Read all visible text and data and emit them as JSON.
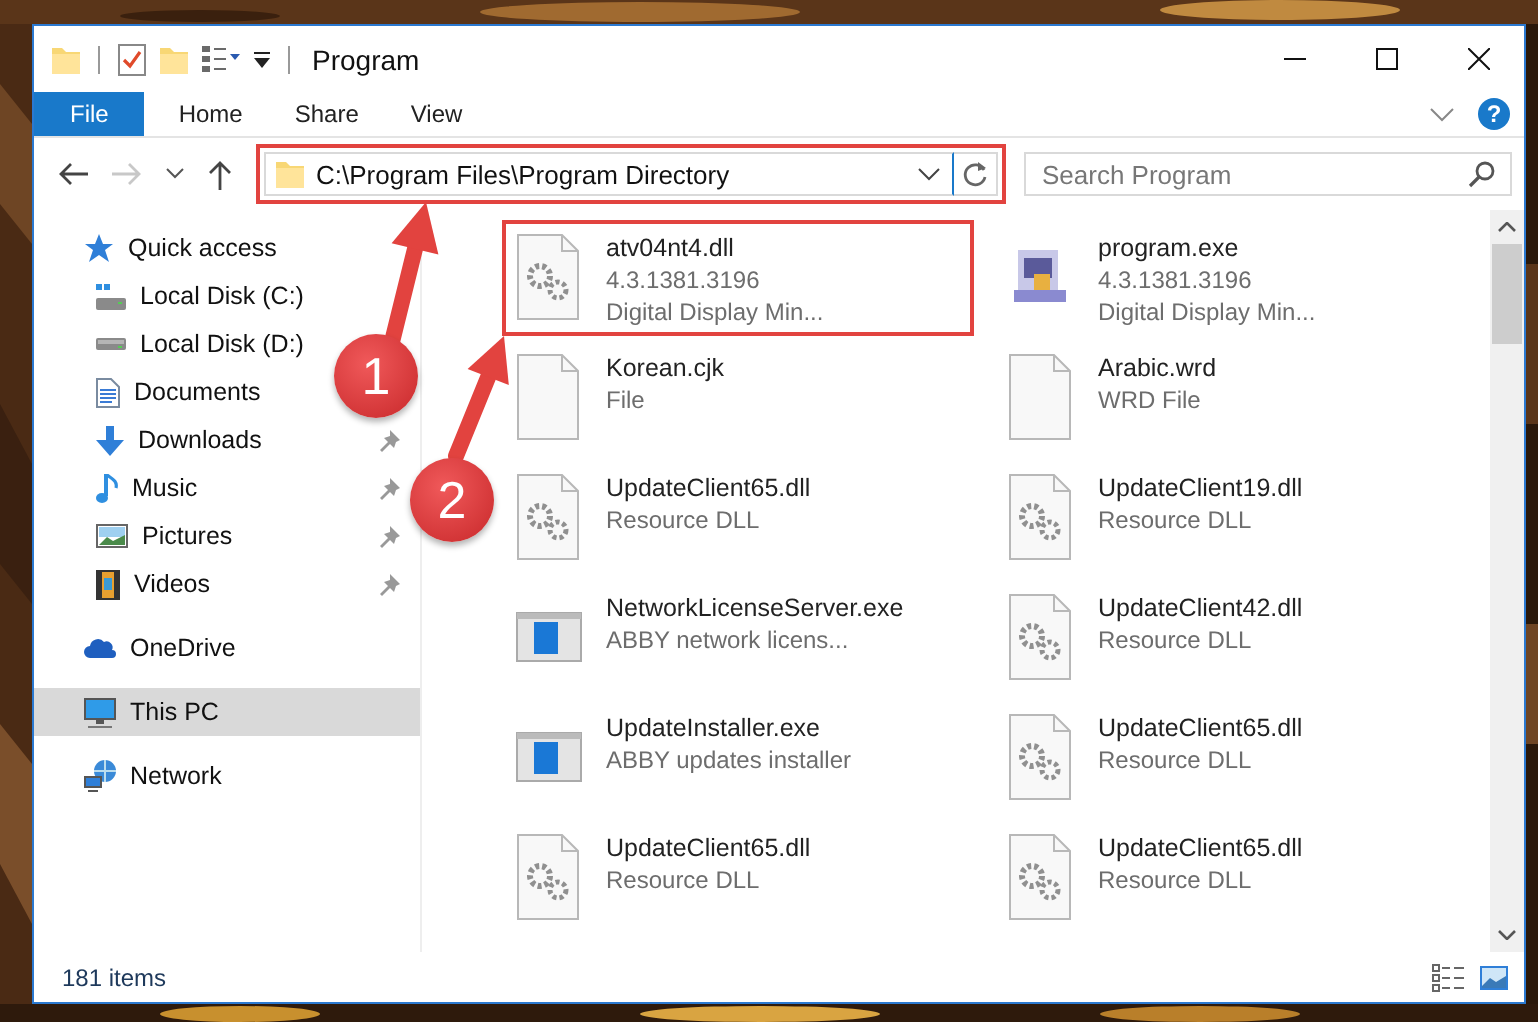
{
  "window": {
    "title": "Program"
  },
  "ribbon": {
    "tabs": [
      {
        "label": "File",
        "kind": "file"
      },
      {
        "label": "Home",
        "kind": "tab"
      },
      {
        "label": "Share",
        "kind": "tab"
      },
      {
        "label": "View",
        "kind": "tab"
      }
    ],
    "help": "?"
  },
  "navigation": {
    "forward_disabled": true
  },
  "address": {
    "path": "C:\\Program Files\\Program Directory",
    "highlighted": true
  },
  "search": {
    "placeholder": "Search Program"
  },
  "sidebar": {
    "items": [
      {
        "label": "Quick access",
        "kind": "star",
        "selected": false,
        "children": [
          {
            "label": "Local Disk (C:)",
            "kind": "drive-c",
            "selected": false
          },
          {
            "label": "Local Disk (D:)",
            "kind": "drive",
            "selected": false
          },
          {
            "label": "Documents",
            "kind": "document",
            "selected": false
          },
          {
            "label": "Downloads",
            "kind": "download",
            "pinned": true,
            "selected": false
          },
          {
            "label": "Music",
            "kind": "music",
            "pinned": true,
            "selected": false
          },
          {
            "label": "Pictures",
            "kind": "pictures",
            "pinned": true,
            "selected": false
          },
          {
            "label": "Videos",
            "kind": "videos",
            "pinned": true,
            "selected": false
          }
        ]
      },
      {
        "label": "OneDrive",
        "kind": "cloud",
        "selected": false
      },
      {
        "label": "This PC",
        "kind": "pc",
        "selected": true
      },
      {
        "label": "Network",
        "kind": "network",
        "selected": false
      }
    ]
  },
  "files": [
    {
      "name": "atv04nt4.dll",
      "details": [
        "4.3.1381.3196",
        "Digital Display Min..."
      ],
      "kind": "gear",
      "highlighted": true
    },
    {
      "name": "program.exe",
      "details": [
        "4.3.1381.3196",
        "Digital Display Min..."
      ],
      "kind": "program",
      "highlighted": false
    },
    {
      "name": "Korean.cjk",
      "details": [
        "File"
      ],
      "kind": "blank",
      "highlighted": false
    },
    {
      "name": "Arabic.wrd",
      "details": [
        "WRD File"
      ],
      "kind": "blank",
      "highlighted": false
    },
    {
      "name": "UpdateClient65.dll",
      "details": [
        "Resource DLL"
      ],
      "kind": "gear",
      "highlighted": false
    },
    {
      "name": "UpdateClient19.dll",
      "details": [
        "Resource DLL"
      ],
      "kind": "gear",
      "highlighted": false
    },
    {
      "name": "NetworkLicenseServer.exe",
      "details": [
        "ABBY network licens..."
      ],
      "kind": "app",
      "highlighted": false
    },
    {
      "name": "UpdateClient42.dll",
      "details": [
        "Resource DLL"
      ],
      "kind": "gear",
      "highlighted": false
    },
    {
      "name": "UpdateInstaller.exe",
      "details": [
        "ABBY updates installer"
      ],
      "kind": "app",
      "highlighted": false
    },
    {
      "name": "UpdateClient65.dll",
      "details": [
        "Resource DLL"
      ],
      "kind": "gear",
      "highlighted": false
    },
    {
      "name": "UpdateClient65.dll",
      "details": [
        "Resource DLL"
      ],
      "kind": "gear",
      "highlighted": false
    },
    {
      "name": "UpdateClient65.dll",
      "details": [
        "Resource DLL"
      ],
      "kind": "gear",
      "highlighted": false
    }
  ],
  "status_bar": {
    "count": "181 items"
  },
  "annotations": [
    {
      "number": "1"
    },
    {
      "number": "2"
    }
  ]
}
